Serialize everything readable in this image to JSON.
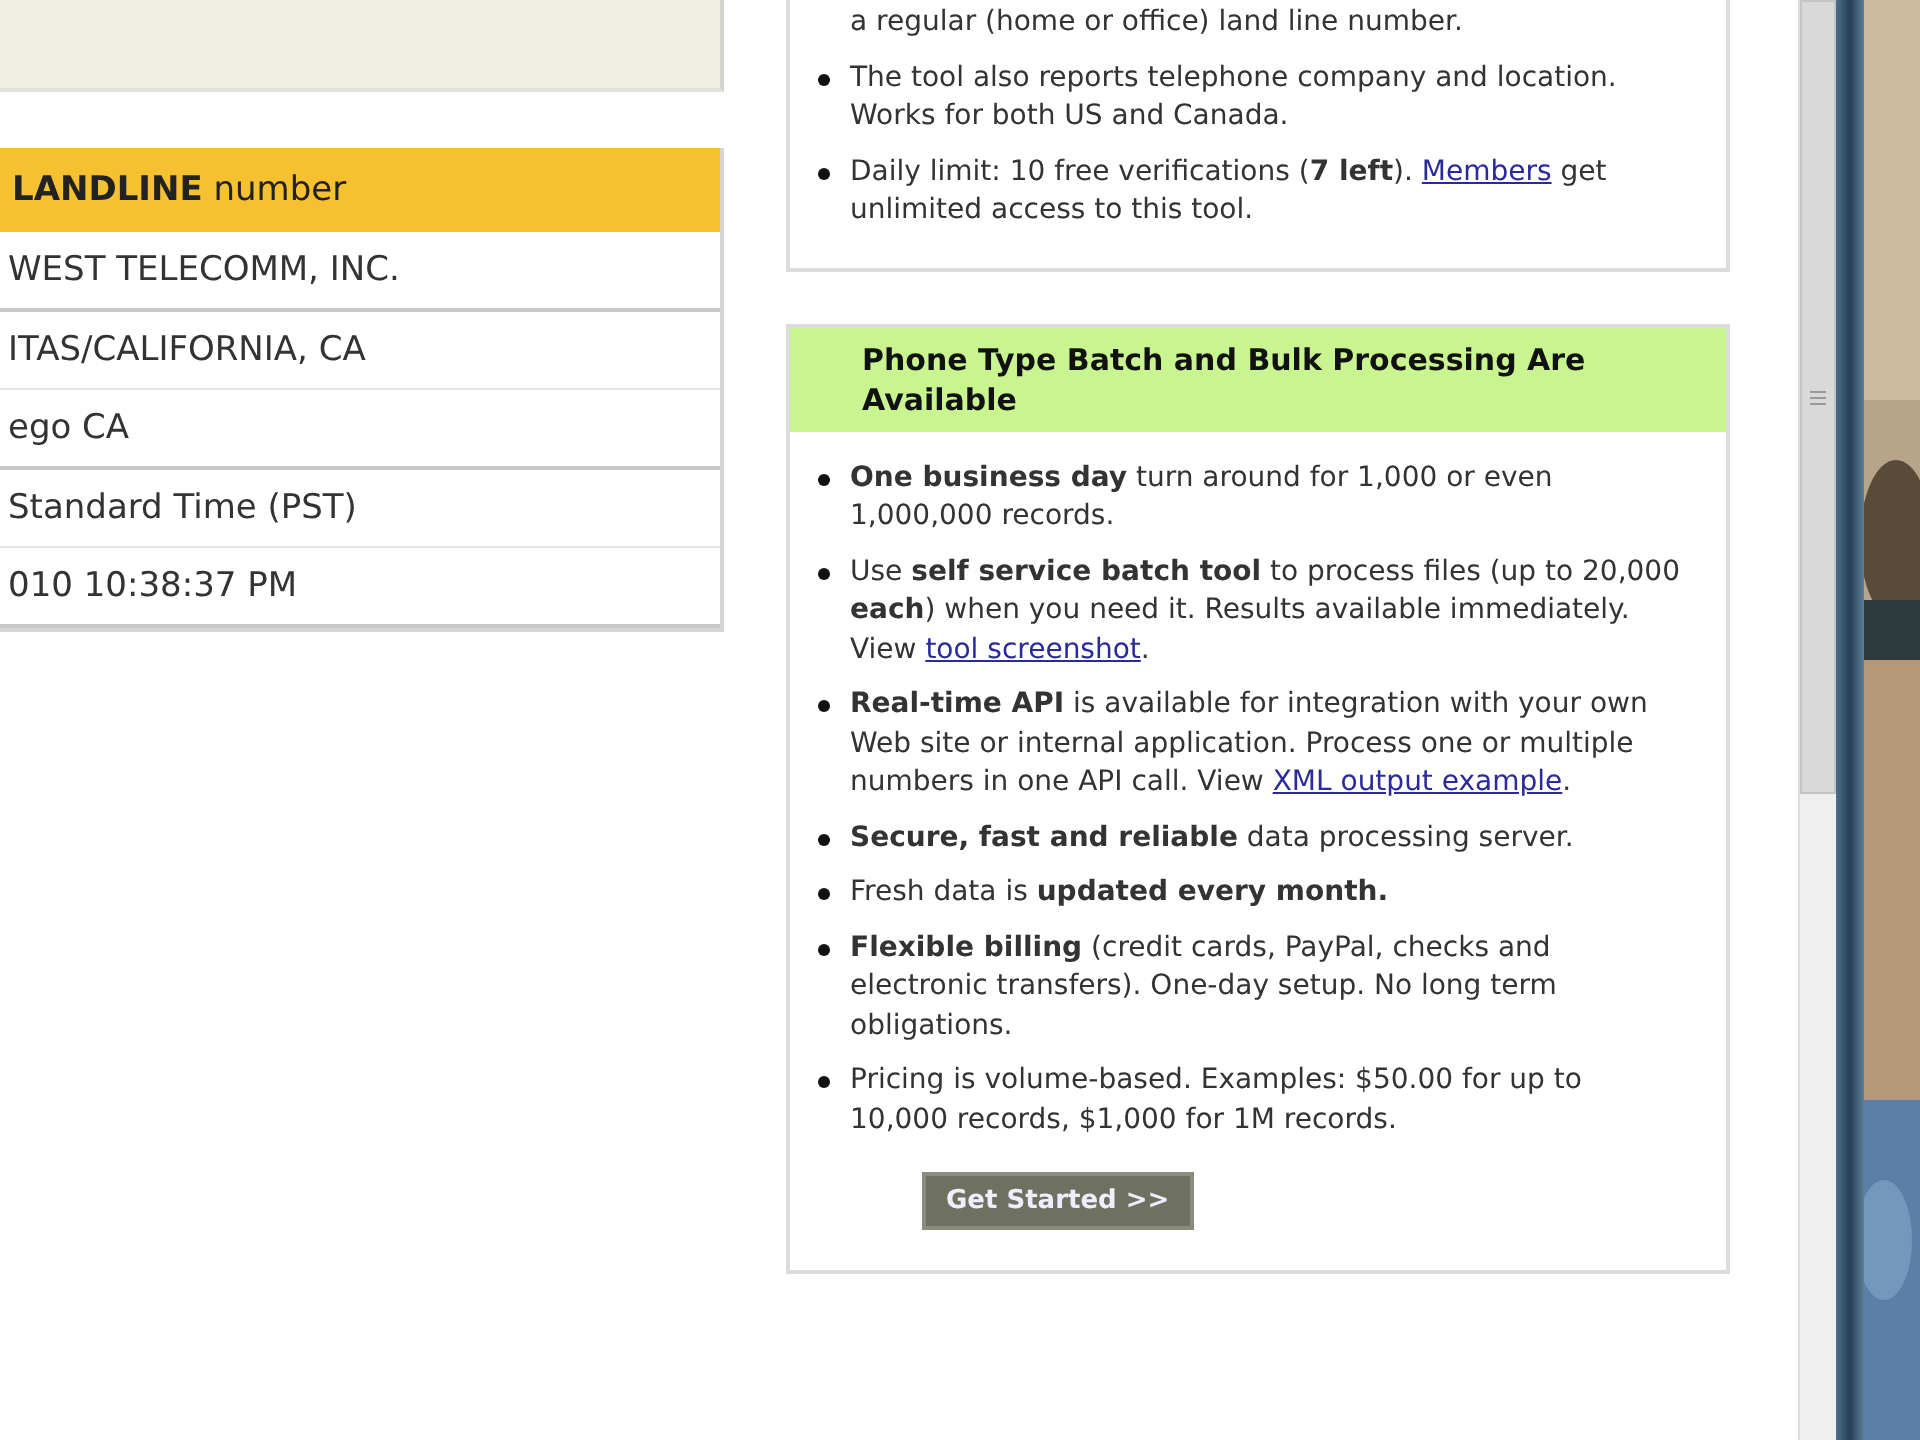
{
  "results_table": {
    "header": "**LANDLINE** number",
    "rows": [
      "WEST TELECOMM, INC.",
      "ITAS/CALIFORNIA, CA",
      "ego CA",
      " Standard Time (PST)",
      "010 10:38:37 PM"
    ]
  },
  "info_card": {
    "items": [
      {
        "bulleted": false,
        "segments": [
          {
            "kind": "text",
            "text": "a regular (home or office) land line number."
          }
        ]
      },
      {
        "bulleted": true,
        "segments": [
          {
            "kind": "text",
            "text": "The tool also reports telephone company and location. Works for both US and Canada."
          }
        ]
      },
      {
        "bulleted": true,
        "segments": [
          {
            "kind": "text",
            "text": "Daily limit: 10 free verifications (**7 left**). "
          },
          {
            "kind": "link",
            "text": "Members"
          },
          {
            "kind": "text",
            "text": " get unlimited access to this tool."
          }
        ]
      }
    ]
  },
  "batch_card": {
    "title": "Phone Type Batch and Bulk Processing Are Available",
    "items": [
      {
        "bulleted": true,
        "segments": [
          {
            "kind": "text",
            "text": "**One business day** turn around for 1,000 or even 1,000,000 records."
          }
        ]
      },
      {
        "bulleted": true,
        "segments": [
          {
            "kind": "text",
            "text": "Use **self service batch tool** to process files (up to 20,000 **each**) when you need it. Results available immediately. View "
          },
          {
            "kind": "link",
            "text": "tool screenshot"
          },
          {
            "kind": "text",
            "text": "."
          }
        ]
      },
      {
        "bulleted": true,
        "segments": [
          {
            "kind": "text",
            "text": "**Real-time API** is available for integration with your own Web site or internal application. Process one or multiple numbers in one API call. View "
          },
          {
            "kind": "link",
            "text": "XML output example"
          },
          {
            "kind": "text",
            "text": "."
          }
        ]
      },
      {
        "bulleted": true,
        "segments": [
          {
            "kind": "text",
            "text": "**Secure, fast and reliable** data processing server."
          }
        ]
      },
      {
        "bulleted": true,
        "segments": [
          {
            "kind": "text",
            "text": "Fresh data is **updated every month.**"
          }
        ]
      },
      {
        "bulleted": true,
        "segments": [
          {
            "kind": "text",
            "text": "**Flexible billing** (credit cards, PayPal, checks and electronic transfers). One-day setup. No long term obligations."
          }
        ]
      },
      {
        "bulleted": true,
        "segments": [
          {
            "kind": "text",
            "text": "Pricing is volume-based. Examples: $50.00 for up to 10,000 records, $1,000 for 1M records."
          }
        ]
      }
    ],
    "button": "Get Started >>"
  }
}
